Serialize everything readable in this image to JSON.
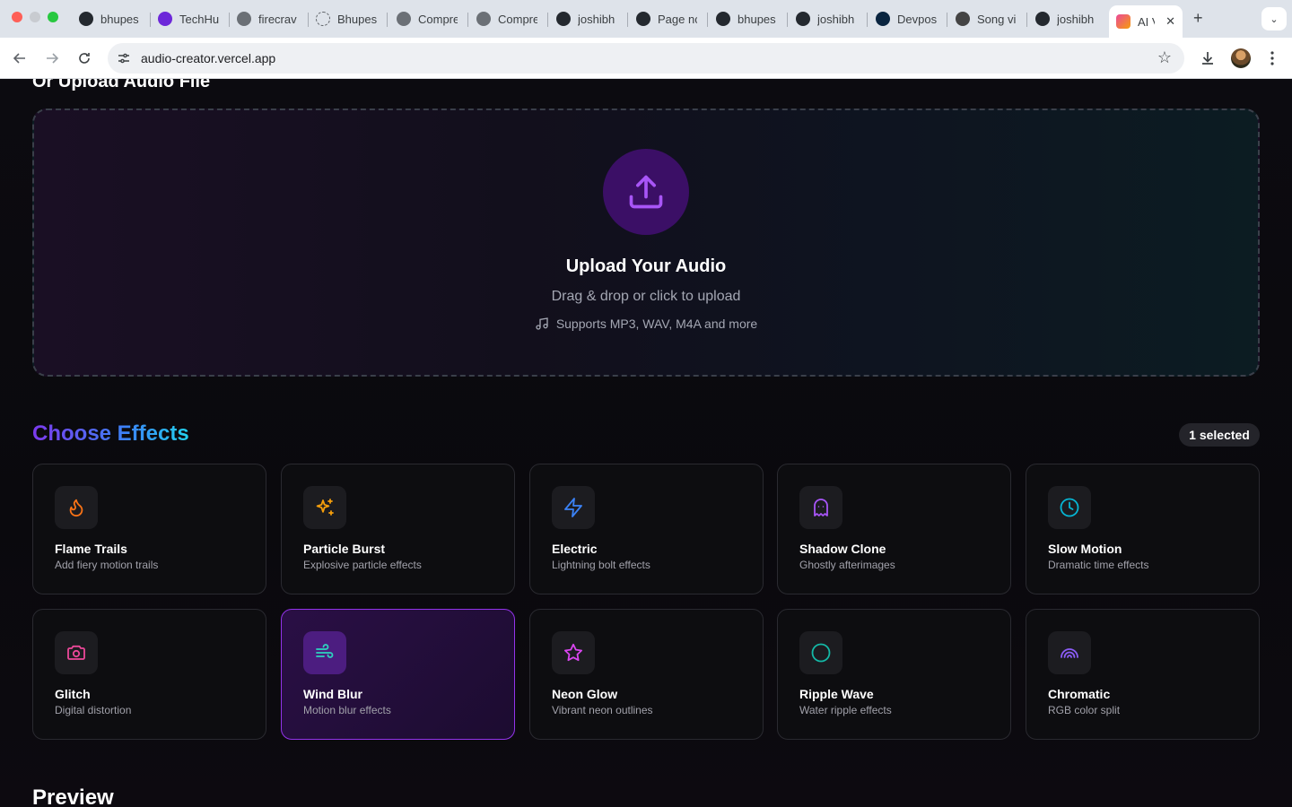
{
  "browser": {
    "tabs": [
      {
        "label": "bhupes",
        "favicon": "github-icon"
      },
      {
        "label": "TechHu",
        "favicon": "techhub-icon"
      },
      {
        "label": "firecrav",
        "favicon": "globe-icon"
      },
      {
        "label": "Bhupes",
        "favicon": "loading-icon"
      },
      {
        "label": "Compre",
        "favicon": "globe-icon"
      },
      {
        "label": "Compre",
        "favicon": "globe-icon"
      },
      {
        "label": "joshibh",
        "favicon": "github-icon"
      },
      {
        "label": "Page nc",
        "favicon": "github-icon"
      },
      {
        "label": "bhupes",
        "favicon": "github-icon"
      },
      {
        "label": "joshibh",
        "favicon": "github-icon"
      },
      {
        "label": "Devpos",
        "favicon": "devpost-icon"
      },
      {
        "label": "Song vi",
        "favicon": "openai-icon"
      },
      {
        "label": "joshibh",
        "favicon": "github-icon"
      },
      {
        "label": "AI V",
        "favicon": "app-icon",
        "active": true
      }
    ],
    "url": "audio-creator.vercel.app"
  },
  "upload": {
    "heading": "Or Upload Audio File",
    "title": "Upload Your Audio",
    "subtitle": "Drag & drop or click to upload",
    "supports": "Supports MP3, WAV, M4A and more"
  },
  "effects": {
    "title": "Choose Effects",
    "selected_badge": "1 selected",
    "items": [
      {
        "name": "Flame Trails",
        "desc": "Add fiery motion trails",
        "icon": "flame-icon",
        "color": "#f97316"
      },
      {
        "name": "Particle Burst",
        "desc": "Explosive particle effects",
        "icon": "sparkles-icon",
        "color": "#f59e0b"
      },
      {
        "name": "Electric",
        "desc": "Lightning bolt effects",
        "icon": "zap-icon",
        "color": "#3b82f6"
      },
      {
        "name": "Shadow Clone",
        "desc": "Ghostly afterimages",
        "icon": "ghost-icon",
        "color": "#a855f7"
      },
      {
        "name": "Slow Motion",
        "desc": "Dramatic time effects",
        "icon": "clock-icon",
        "color": "#06b6d4"
      },
      {
        "name": "Glitch",
        "desc": "Digital distortion",
        "icon": "camera-icon",
        "color": "#ec4899"
      },
      {
        "name": "Wind Blur",
        "desc": "Motion blur effects",
        "icon": "wind-icon",
        "color": "#2dd4bf",
        "selected": true
      },
      {
        "name": "Neon Glow",
        "desc": "Vibrant neon outlines",
        "icon": "star-icon",
        "color": "#d946ef"
      },
      {
        "name": "Ripple Wave",
        "desc": "Water ripple effects",
        "icon": "circle-icon",
        "color": "#14b8a6"
      },
      {
        "name": "Chromatic",
        "desc": "RGB color split",
        "icon": "rainbow-icon",
        "color": "#8b5cf6"
      }
    ]
  },
  "preview": {
    "title": "Preview"
  }
}
